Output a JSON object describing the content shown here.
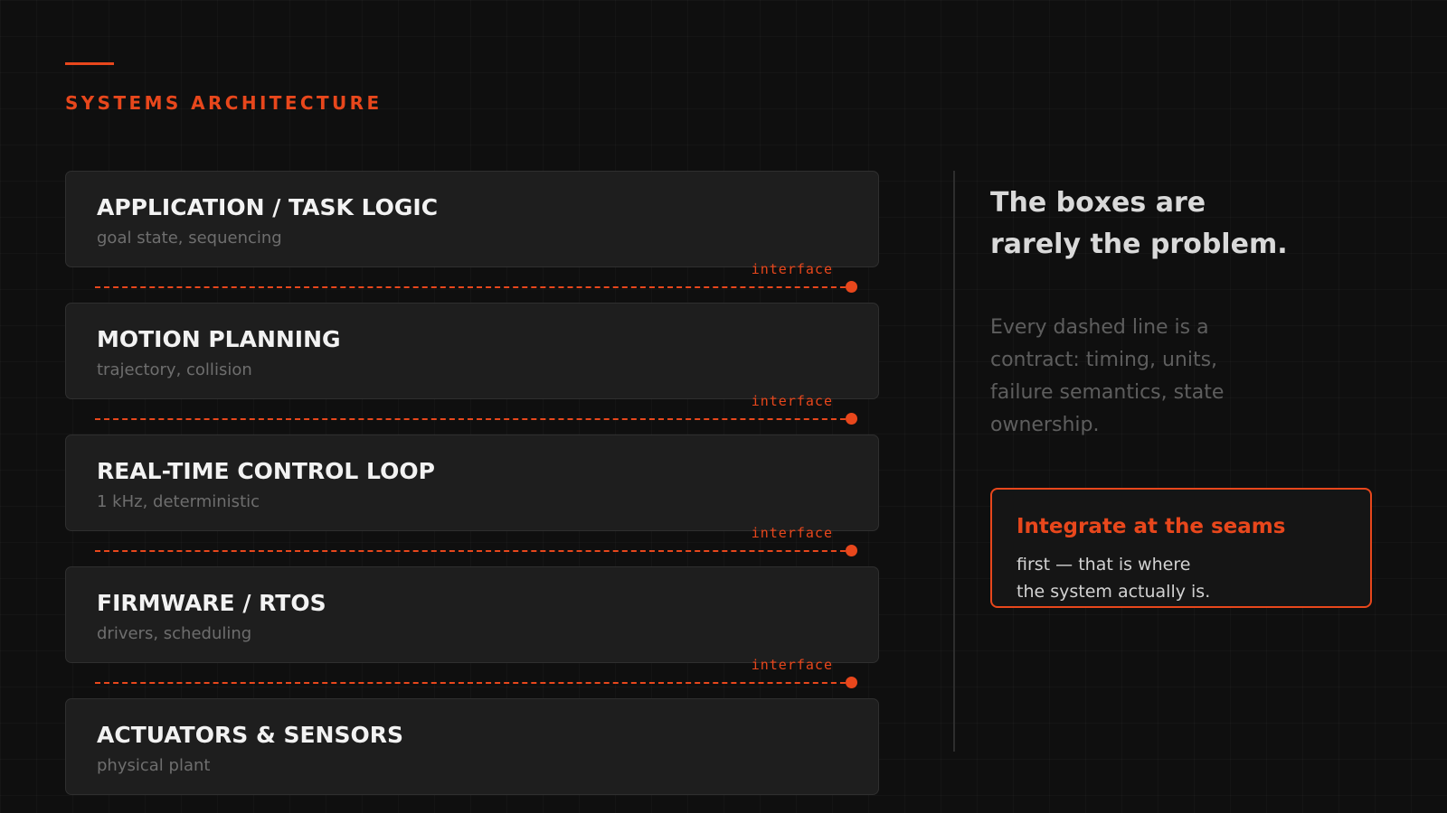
{
  "section_label": "SYSTEMS ARCHITECTURE",
  "layers": [
    {
      "title": "APPLICATION / TASK LOGIC",
      "subtitle": "goal state, sequencing"
    },
    {
      "title": "MOTION PLANNING",
      "subtitle": "trajectory, collision"
    },
    {
      "title": "REAL-TIME CONTROL LOOP",
      "subtitle": "1 kHz, deterministic"
    },
    {
      "title": "FIRMWARE / RTOS",
      "subtitle": "drivers, scheduling"
    },
    {
      "title": "ACTUATORS & SENSORS",
      "subtitle": "physical plant"
    }
  ],
  "interfaces": [
    {
      "label": "interface"
    },
    {
      "label": "interface"
    },
    {
      "label": "interface"
    },
    {
      "label": "interface"
    }
  ],
  "sidebar": {
    "headline_lines": [
      "The boxes are",
      "rarely the problem."
    ],
    "body_lines": [
      "Every dashed line is a",
      "contract: timing, units,",
      "failure semantics, state",
      "ownership."
    ],
    "callout": {
      "title": "Integrate at the seams",
      "body_lines": [
        "first — that is where",
        "the system actually is."
      ]
    }
  },
  "colors": {
    "accent": "#e8471c",
    "background": "#0f0f0f",
    "panel": "#1e1e1e"
  }
}
